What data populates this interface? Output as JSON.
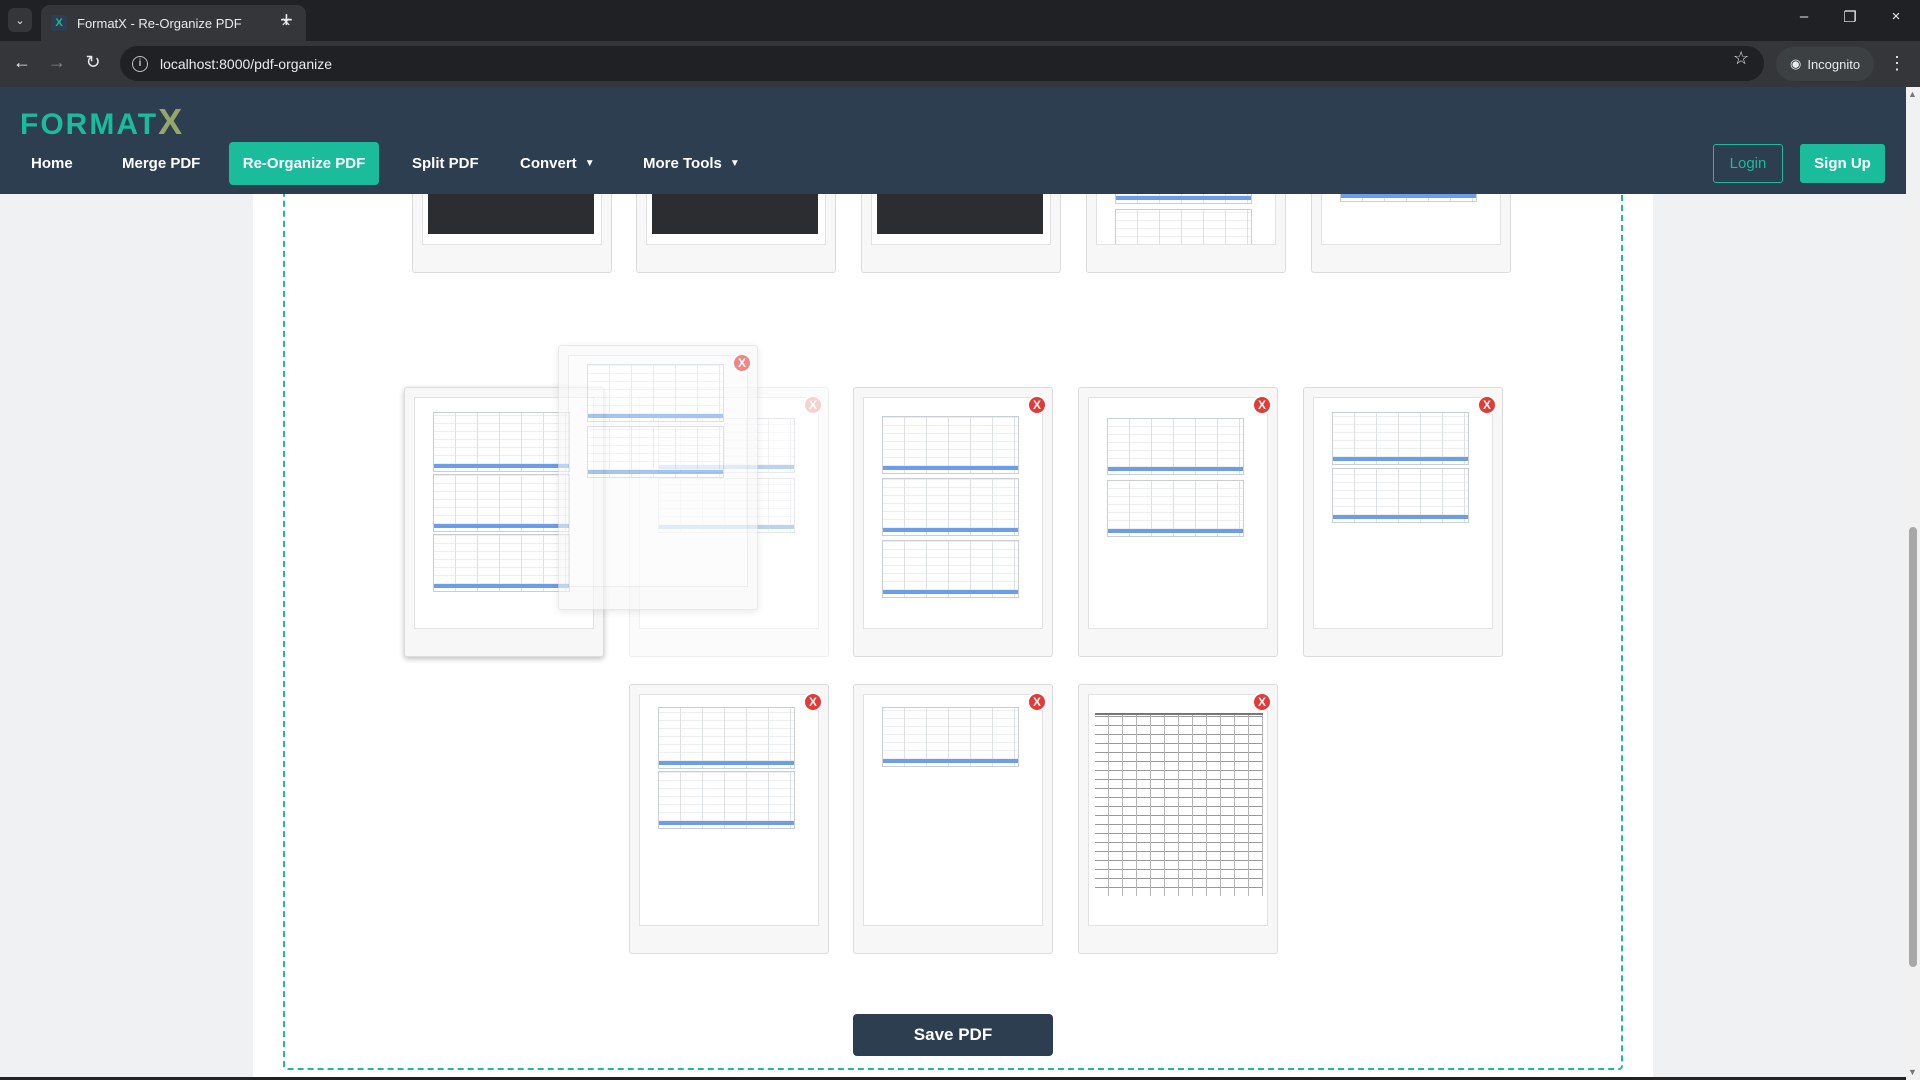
{
  "browser": {
    "tab_title": "FormatX - Re-Organize PDF",
    "url": "localhost:8000/pdf-organize",
    "incognito_label": "Incognito"
  },
  "site": {
    "logo_main": "FORMAT",
    "logo_x": "X",
    "nav": [
      {
        "label": "Home",
        "active": false
      },
      {
        "label": "Merge PDF",
        "active": false
      },
      {
        "label": "Re-Organize PDF",
        "active": true
      },
      {
        "label": "Split PDF",
        "active": false
      },
      {
        "label": "Convert",
        "active": false,
        "dropdown": true
      },
      {
        "label": "More Tools",
        "active": false,
        "dropdown": true
      }
    ],
    "login_label": "Login",
    "signup_label": "Sign Up"
  },
  "organizer": {
    "delete_label": "X",
    "pages": [
      {
        "kind": "code"
      },
      {
        "kind": "code"
      },
      {
        "kind": "code"
      },
      {
        "kind": "sheet"
      },
      {
        "kind": "sheet"
      },
      {
        "kind": "sheet",
        "state": "dragging-source"
      },
      {
        "kind": "sheet",
        "state": "placeholder"
      },
      {
        "kind": "sheet"
      },
      {
        "kind": "sheet"
      },
      {
        "kind": "sheet"
      },
      {
        "kind": "sheet"
      },
      {
        "kind": "sheet"
      },
      {
        "kind": "table"
      }
    ],
    "save_label": "Save PDF"
  },
  "colors": {
    "header_bg": "#2c3e50",
    "accent": "#1abc9c",
    "delete_red": "#e53935"
  }
}
